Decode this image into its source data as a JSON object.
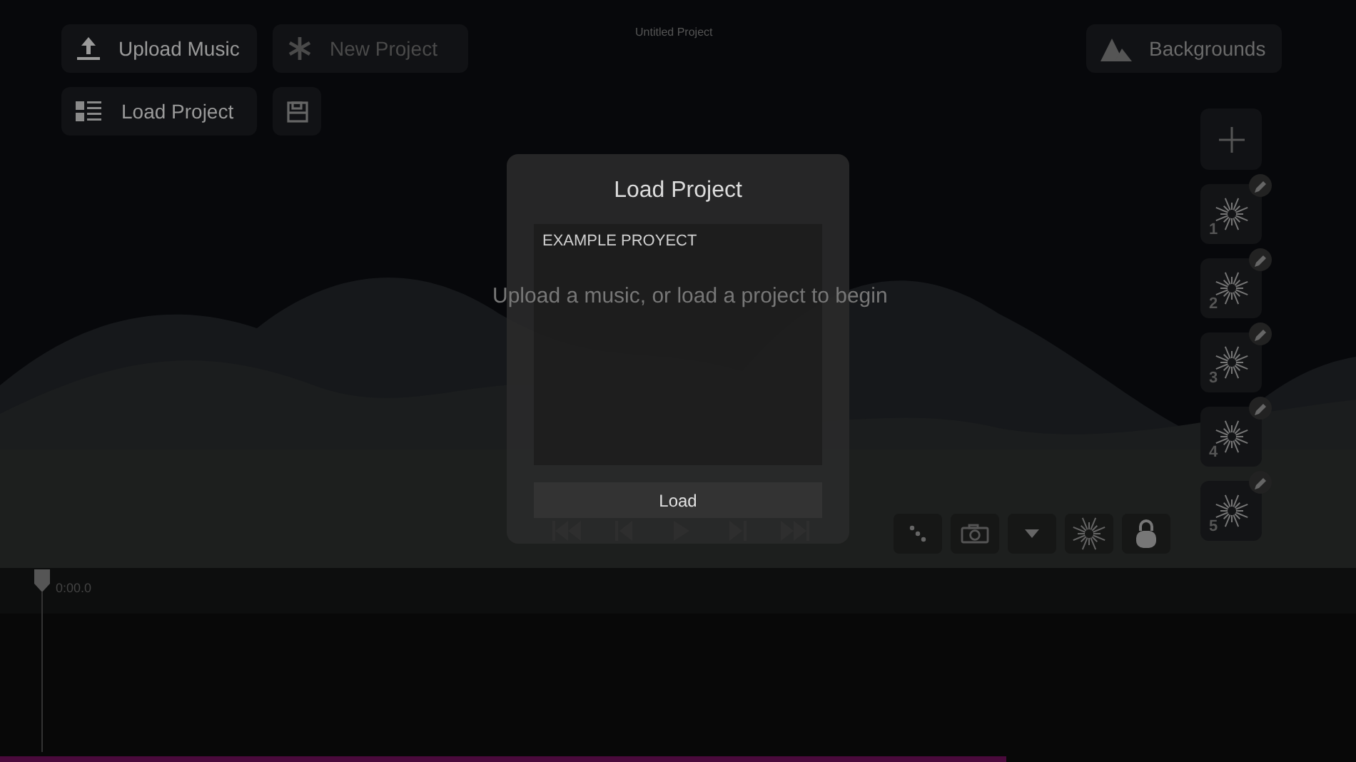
{
  "top_buttons": [
    {
      "kind": "upload",
      "label": "Upload Music",
      "disabled": false
    },
    {
      "kind": "new",
      "label": "New Project",
      "disabled": true
    }
  ],
  "load_button": {
    "label": "Load Project"
  },
  "project_title": "Untitled Project",
  "backgrounds_button": {
    "label": "Backgrounds"
  },
  "hint": "Upload a music, or load a project to begin",
  "presets": [
    {
      "number": "1"
    },
    {
      "number": "2"
    },
    {
      "number": "3"
    },
    {
      "number": "4"
    },
    {
      "number": "5"
    }
  ],
  "dialog": {
    "title": "Load Project",
    "projects": [
      "EXAMPLE PROYECT"
    ],
    "button": "Load"
  },
  "timeline": {
    "time": "0:00.0"
  },
  "progress": {
    "level": 0.742
  }
}
